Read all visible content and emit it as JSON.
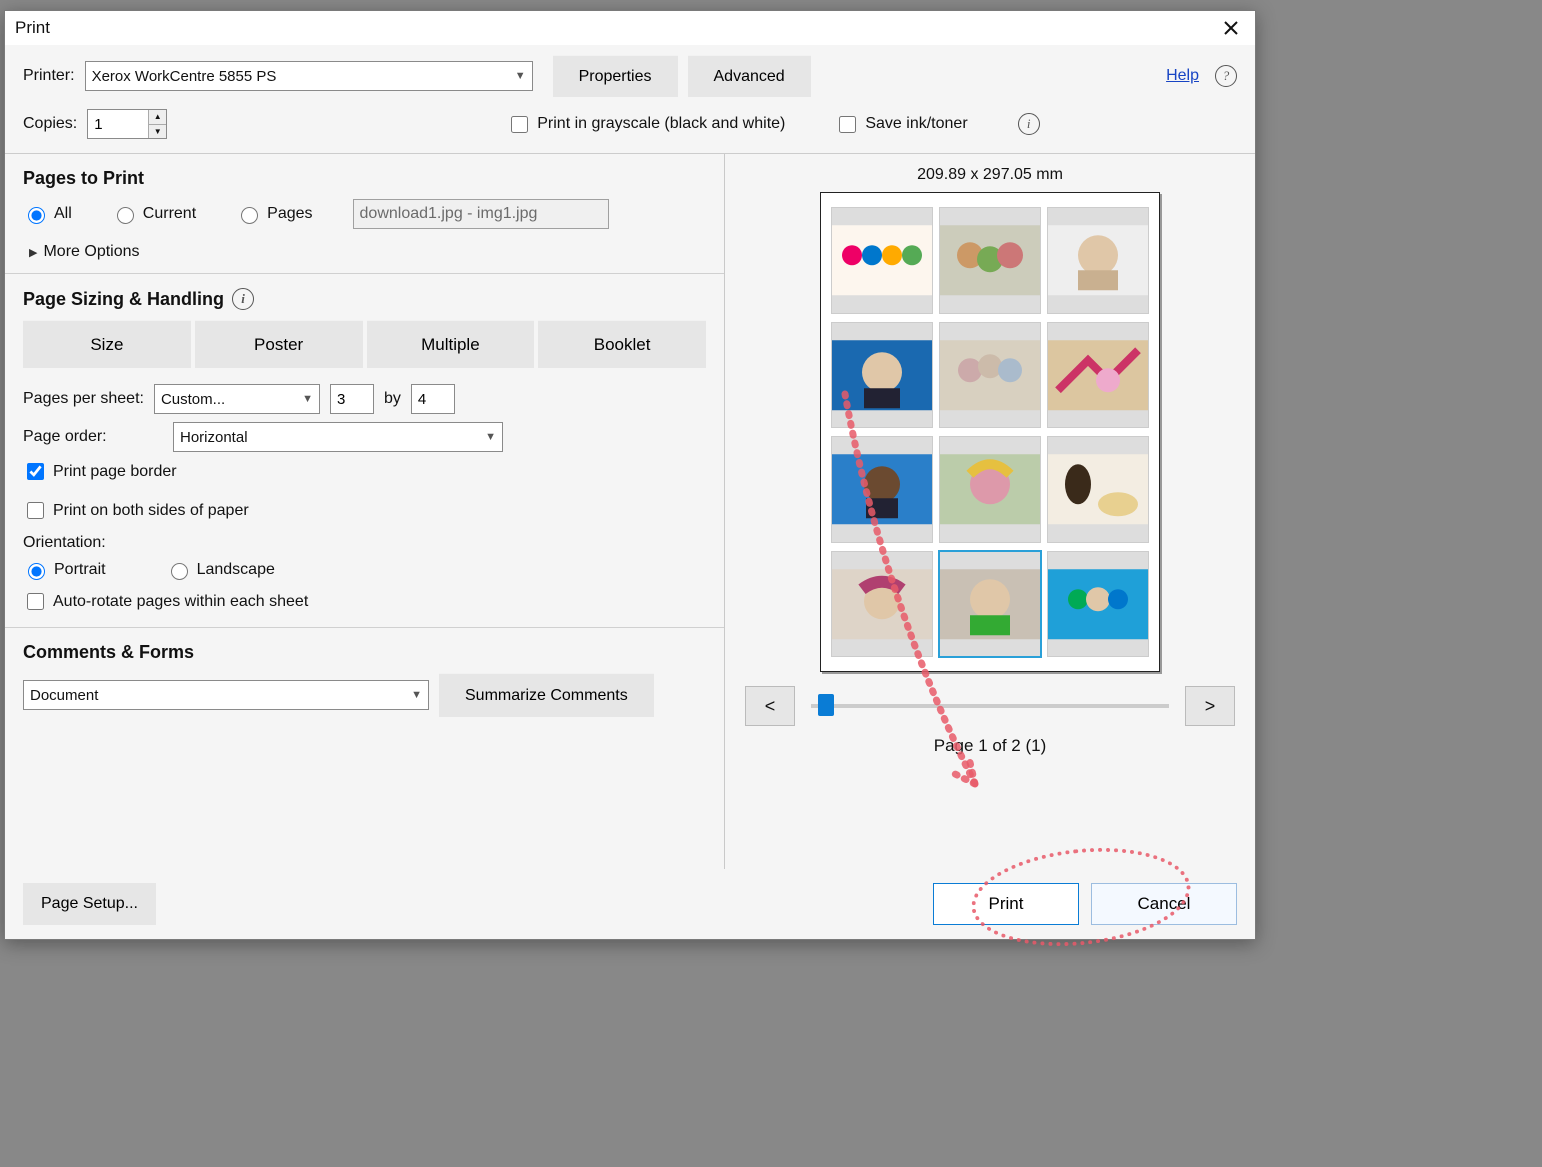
{
  "title": "Print",
  "help": "Help",
  "top": {
    "printer_label": "Printer:",
    "printer_value": "Xerox WorkCentre 5855 PS",
    "properties": "Properties",
    "advanced": "Advanced",
    "copies_label": "Copies:",
    "copies_value": "1",
    "grayscale": "Print in grayscale (black and white)",
    "saveink": "Save ink/toner"
  },
  "pages_to_print": {
    "title": "Pages to Print",
    "all": "All",
    "current": "Current",
    "pages": "Pages",
    "range_placeholder": "download1.jpg - img1.jpg",
    "more": "More Options"
  },
  "sizing": {
    "title": "Page Sizing & Handling",
    "size": "Size",
    "poster": "Poster",
    "multiple": "Multiple",
    "booklet": "Booklet",
    "pps_label": "Pages per sheet:",
    "pps_value": "Custom...",
    "cols": "3",
    "by": "by",
    "rows": "4",
    "order_label": "Page order:",
    "order_value": "Horizontal",
    "border": "Print page border",
    "duplex": "Print on both sides of paper",
    "orientation_label": "Orientation:",
    "portrait": "Portrait",
    "landscape": "Landscape",
    "autorotate": "Auto-rotate pages within each sheet"
  },
  "comments": {
    "title": "Comments & Forms",
    "value": "Document",
    "summarize": "Summarize Comments"
  },
  "preview": {
    "dims": "209.89 x 297.05 mm",
    "page_indicator": "Page 1 of 2 (1)",
    "prev": "<",
    "next": ">"
  },
  "footer": {
    "page_setup": "Page Setup...",
    "print": "Print",
    "cancel": "Cancel"
  }
}
